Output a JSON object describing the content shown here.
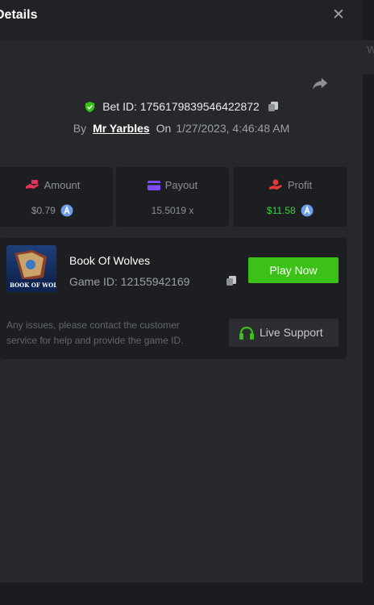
{
  "background": {
    "fragment_text": "W"
  },
  "modal": {
    "title": "Details",
    "close_symbol": "✕",
    "share_icon": "share-arrow-icon"
  },
  "bet": {
    "id_label": "Bet ID: 1756179839546422872",
    "by_label": "By",
    "user": "Mr Yarbles",
    "on_label": "On",
    "datetime": "1/27/2023, 4:46:48 AM"
  },
  "stats": {
    "amount": {
      "label": "Amount",
      "value": "$0.79",
      "icon": "money-hand-icon"
    },
    "payout": {
      "label": "Payout",
      "value": "15.5019 x",
      "icon": "card-icon"
    },
    "profit": {
      "label": "Profit",
      "value": "$11.58",
      "icon": "profit-hand-icon"
    }
  },
  "game": {
    "name": "Book Of Wolves",
    "id_label": "Game ID: 12155942169",
    "play_label": "Play Now",
    "issue_text": "Any issues, please contact the customer service for help and provide the game ID.",
    "support_label": "Live Support",
    "thumb_text": "BOOK OF WOLVES"
  },
  "colors": {
    "accent_green": "#3bc117",
    "profit_green": "#3ecf3e",
    "amount_pink": "#e2335a",
    "payout_purple": "#7b4dff",
    "profit_red": "#e23a3a",
    "coin_blue": "#6b9de8"
  }
}
